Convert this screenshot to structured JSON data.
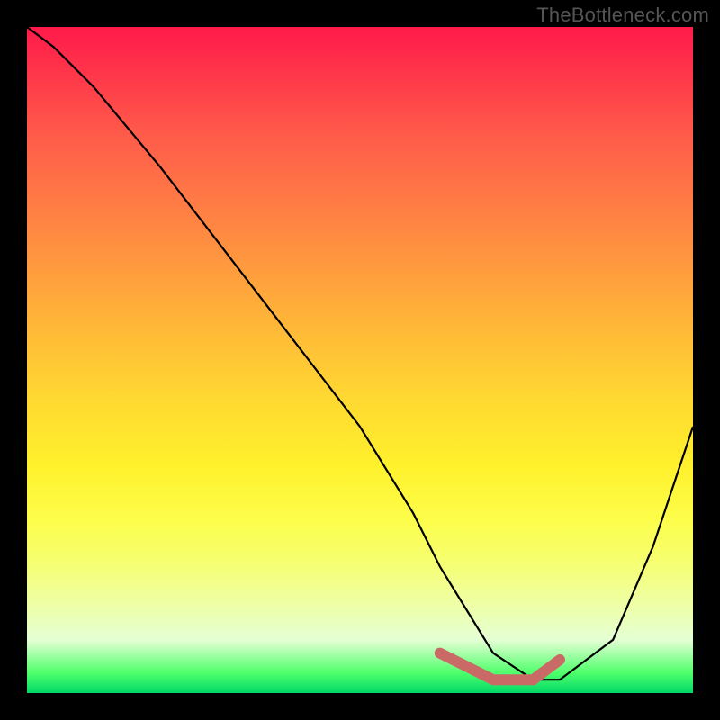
{
  "watermark": "TheBottleneck.com",
  "chart_data": {
    "type": "line",
    "title": "",
    "xlabel": "",
    "ylabel": "",
    "xlim": [
      0,
      100
    ],
    "ylim": [
      0,
      100
    ],
    "grid": false,
    "legend": false,
    "series": [
      {
        "name": "curve",
        "x": [
          0,
          4,
          10,
          20,
          30,
          40,
          50,
          58,
          62,
          70,
          76,
          80,
          88,
          94,
          100
        ],
        "values": [
          100,
          97,
          91,
          79,
          66,
          53,
          40,
          27,
          19,
          6,
          2,
          2,
          8,
          22,
          40
        ]
      }
    ],
    "highlight": {
      "name": "minimum-band",
      "x": [
        62,
        70,
        76,
        80
      ],
      "values": [
        6,
        2,
        2,
        5
      ]
    },
    "background": "red-yellow-green vertical gradient"
  }
}
